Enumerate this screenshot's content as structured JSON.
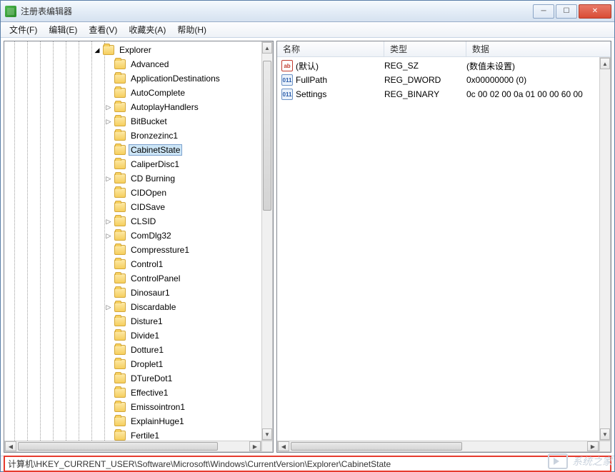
{
  "window": {
    "title": "注册表编辑器"
  },
  "menu": {
    "file": "文件(F)",
    "edit": "编辑(E)",
    "view": "查看(V)",
    "favorites": "收藏夹(A)",
    "help": "帮助(H)"
  },
  "tree": {
    "parent": "Explorer",
    "children": [
      {
        "label": "Advanced",
        "expandable": false
      },
      {
        "label": "ApplicationDestinations",
        "expandable": false
      },
      {
        "label": "AutoComplete",
        "expandable": false
      },
      {
        "label": "AutoplayHandlers",
        "expandable": true
      },
      {
        "label": "BitBucket",
        "expandable": true
      },
      {
        "label": "Bronzezinc1",
        "expandable": false
      },
      {
        "label": "CabinetState",
        "expandable": false,
        "selected": true
      },
      {
        "label": "CaliperDisc1",
        "expandable": false
      },
      {
        "label": "CD Burning",
        "expandable": true
      },
      {
        "label": "CIDOpen",
        "expandable": false
      },
      {
        "label": "CIDSave",
        "expandable": false
      },
      {
        "label": "CLSID",
        "expandable": true
      },
      {
        "label": "ComDlg32",
        "expandable": true
      },
      {
        "label": "Compressture1",
        "expandable": false
      },
      {
        "label": "Control1",
        "expandable": false
      },
      {
        "label": "ControlPanel",
        "expandable": false
      },
      {
        "label": "Dinosaur1",
        "expandable": false
      },
      {
        "label": "Discardable",
        "expandable": true
      },
      {
        "label": "Disture1",
        "expandable": false
      },
      {
        "label": "Divide1",
        "expandable": false
      },
      {
        "label": "Dotture1",
        "expandable": false
      },
      {
        "label": "Droplet1",
        "expandable": false
      },
      {
        "label": "DTureDot1",
        "expandable": false
      },
      {
        "label": "Effective1",
        "expandable": false
      },
      {
        "label": "Emissointron1",
        "expandable": false
      },
      {
        "label": "ExplainHuge1",
        "expandable": false
      },
      {
        "label": "Fertile1",
        "expandable": false
      }
    ]
  },
  "values": {
    "headers": {
      "name": "名称",
      "type": "类型",
      "data": "数据"
    },
    "rows": [
      {
        "icon": "str",
        "name": "(默认)",
        "type": "REG_SZ",
        "data": "(数值未设置)"
      },
      {
        "icon": "bin",
        "name": "FullPath",
        "type": "REG_DWORD",
        "data": "0x00000000 (0)"
      },
      {
        "icon": "bin",
        "name": "Settings",
        "type": "REG_BINARY",
        "data": "0c 00 02 00 0a 01 00 00 60 00"
      }
    ]
  },
  "status": {
    "path": "计算机\\HKEY_CURRENT_USER\\Software\\Microsoft\\Windows\\CurrentVersion\\Explorer\\CabinetState"
  },
  "watermark": {
    "text": "系统之家"
  },
  "icon_labels": {
    "str": "ab",
    "bin": "011"
  }
}
